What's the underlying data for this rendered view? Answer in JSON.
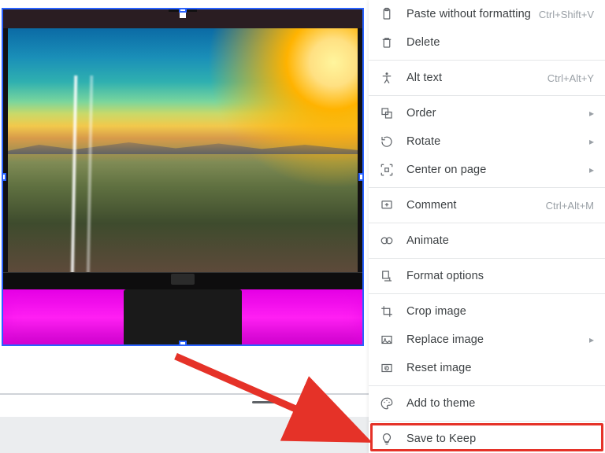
{
  "menu": {
    "items": [
      {
        "id": "paste-without-formatting",
        "label": "Paste without formatting",
        "shortcut": "Ctrl+Shift+V",
        "icon": "clipboard-icon",
        "submenu": false
      },
      {
        "id": "delete",
        "label": "Delete",
        "shortcut": "",
        "icon": "trash-icon",
        "submenu": false
      },
      {
        "sep": true
      },
      {
        "id": "alt-text",
        "label": "Alt text",
        "shortcut": "Ctrl+Alt+Y",
        "icon": "accessibility-icon",
        "submenu": false
      },
      {
        "sep": true
      },
      {
        "id": "order",
        "label": "Order",
        "shortcut": "",
        "icon": "order-icon",
        "submenu": true
      },
      {
        "id": "rotate",
        "label": "Rotate",
        "shortcut": "",
        "icon": "rotate-icon",
        "submenu": true
      },
      {
        "id": "center-on-page",
        "label": "Center on page",
        "shortcut": "",
        "icon": "center-icon",
        "submenu": true
      },
      {
        "sep": true
      },
      {
        "id": "comment",
        "label": "Comment",
        "shortcut": "Ctrl+Alt+M",
        "icon": "comment-icon",
        "submenu": false
      },
      {
        "sep": true
      },
      {
        "id": "animate",
        "label": "Animate",
        "shortcut": "",
        "icon": "animate-icon",
        "submenu": false
      },
      {
        "sep": true
      },
      {
        "id": "format-options",
        "label": "Format options",
        "shortcut": "",
        "icon": "format-options-icon",
        "submenu": false
      },
      {
        "sep": true
      },
      {
        "id": "crop-image",
        "label": "Crop image",
        "shortcut": "",
        "icon": "crop-icon",
        "submenu": false
      },
      {
        "id": "replace-image",
        "label": "Replace image",
        "shortcut": "",
        "icon": "replace-image-icon",
        "submenu": true
      },
      {
        "id": "reset-image",
        "label": "Reset image",
        "shortcut": "",
        "icon": "reset-image-icon",
        "submenu": false
      },
      {
        "sep": true
      },
      {
        "id": "add-to-theme",
        "label": "Add to theme",
        "shortcut": "",
        "icon": "palette-icon",
        "submenu": false
      },
      {
        "sep": true
      },
      {
        "id": "save-to-keep",
        "label": "Save to Keep",
        "shortcut": "",
        "icon": "lightbulb-icon",
        "submenu": false
      }
    ]
  },
  "annotation": {
    "highlight_target": "save-to-keep",
    "arrow_color": "#e53228"
  }
}
